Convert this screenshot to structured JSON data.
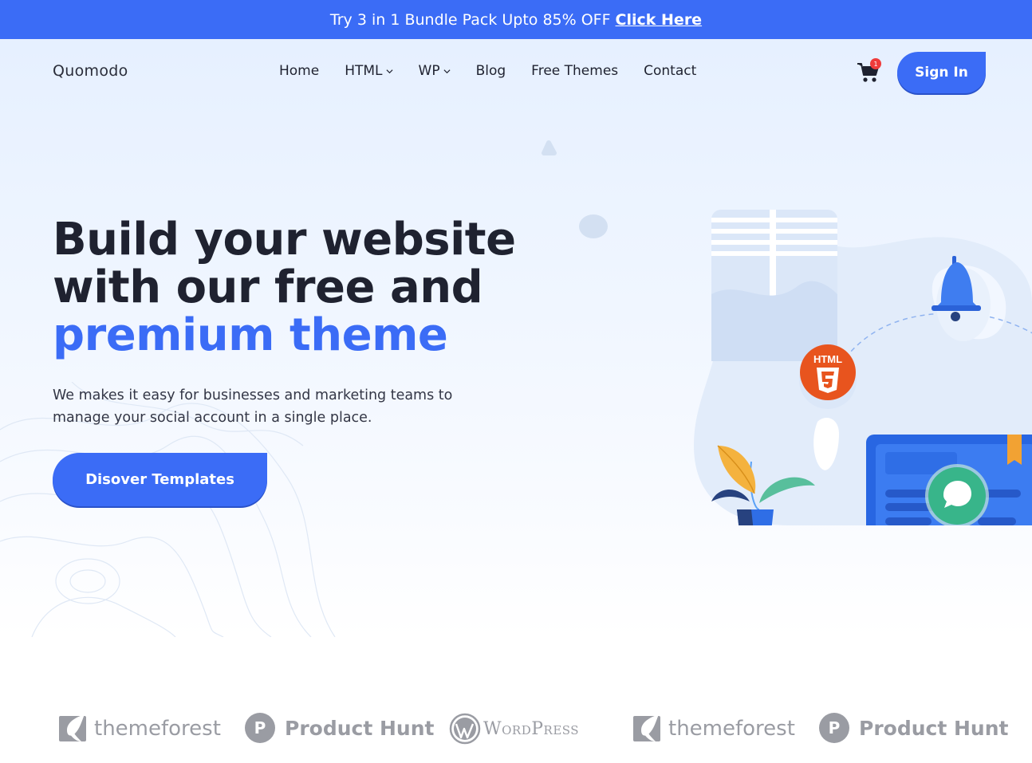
{
  "promo": {
    "text": "Try 3 in 1 Bundle Pack Upto 85% OFF",
    "link_label": "Click Here"
  },
  "header": {
    "logo": "Quomodo",
    "nav": [
      {
        "label": "Home"
      },
      {
        "label": "HTML",
        "has_dropdown": true
      },
      {
        "label": "WP",
        "has_dropdown": true
      },
      {
        "label": "Blog"
      },
      {
        "label": "Free Themes"
      },
      {
        "label": "Contact"
      }
    ],
    "cart_count": "1",
    "signin_label": "Sign In"
  },
  "hero": {
    "headline_line1": "Build your website",
    "headline_line2": "with our free and",
    "headline_line3": "premium theme",
    "subtext": "We makes it easy for businesses and marketing teams to manage your social account in a single place.",
    "cta_label": "Disover Templates",
    "html5_badge_label": "HTML"
  },
  "brands": [
    {
      "name": "themeforest",
      "icon": "themeforest-leaf-icon"
    },
    {
      "name": "Product Hunt",
      "icon": "product-hunt-icon",
      "icon_letter": "P"
    },
    {
      "name": "WordPress",
      "icon": "wordpress-icon"
    },
    {
      "name": "themeforest",
      "icon": "themeforest-leaf-icon"
    },
    {
      "name": "Product Hunt",
      "icon": "product-hunt-icon",
      "icon_letter": "P"
    }
  ],
  "colors": {
    "primary": "#3b6cf6",
    "text_dark": "#1f2230",
    "badge_red": "#ef3b3b",
    "html5_orange": "#e8541e",
    "brand_gray": "#9a9ca3"
  }
}
